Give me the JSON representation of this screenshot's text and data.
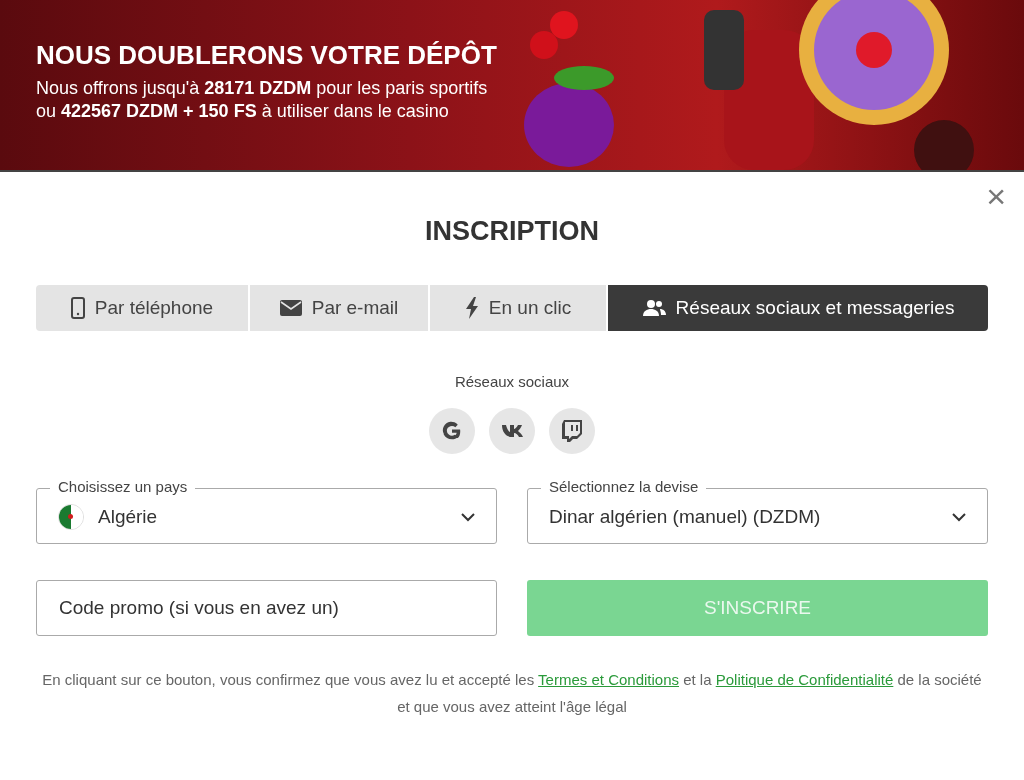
{
  "banner": {
    "title": "NOUS DOUBLERONS VOTRE DÉPÔT",
    "lines": [
      "Nous offrons jusqu'à **28171 DZDM** pour les paris sportifs",
      "ou **422567 DZDM + 150 FS** à utiliser dans le casino"
    ]
  },
  "dialog": {
    "close": "×",
    "title": "INSCRIPTION",
    "tabs": [
      {
        "kind": "phone",
        "label": "Par téléphone",
        "selected": false
      },
      {
        "kind": "mail",
        "label": "Par e-mail",
        "selected": false
      },
      {
        "kind": "bolt",
        "label": "En un clic",
        "selected": false
      },
      {
        "kind": "people",
        "label": "Réseaux sociaux et messageries",
        "selected": true
      }
    ],
    "social": {
      "label": "Réseaux sociaux",
      "buttons": [
        {
          "kind": "g"
        },
        {
          "kind": "vk"
        },
        {
          "kind": "tw"
        }
      ]
    },
    "country": {
      "label": "Choisissez un pays",
      "value": "Algérie"
    },
    "currency": {
      "label": "Sélectionnez la devise",
      "value": "Dinar algérien (manuel) (DZDM)"
    },
    "promo": {
      "placeholder": "Code promo (si vous en avez un)"
    },
    "submit": {
      "label": "S'INSCRIRE",
      "disabled": true
    },
    "legal": [
      {
        "kind": "text",
        "text": "En cliquant sur ce bouton, vous confirmez que vous avez lu et accepté les "
      },
      {
        "kind": "link",
        "text": "Termes et Conditions"
      },
      {
        "kind": "text",
        "text": " et la "
      },
      {
        "kind": "link",
        "text": "Politique de Confidentialité"
      },
      {
        "kind": "text",
        "text": " de la société et que vous avez atteint l'âge légal"
      }
    ]
  }
}
